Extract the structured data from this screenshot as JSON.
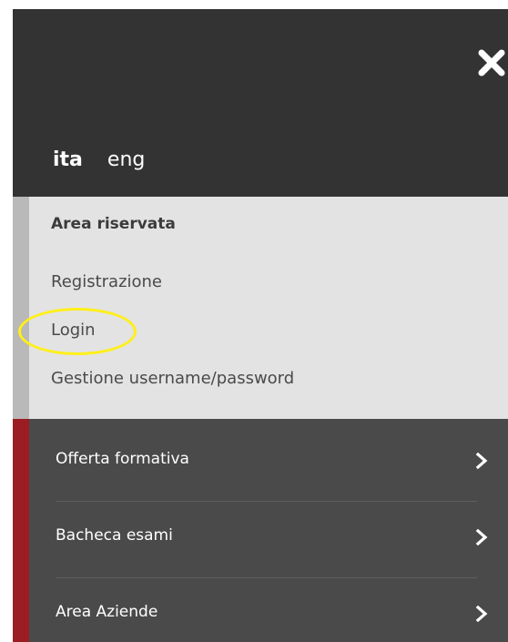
{
  "header": {
    "close_icon": "close-icon",
    "languages": {
      "active": "ita",
      "other": "eng"
    }
  },
  "reserved_area": {
    "title": "Area riservata",
    "links": {
      "registration": "Registrazione",
      "login": "Login",
      "manage": "Gestione username/password"
    },
    "highlight_color": "#ffef1a"
  },
  "nav": {
    "items": [
      {
        "label": "Offerta formativa",
        "icon": "chevron-right-icon"
      },
      {
        "label": "Bacheca esami",
        "icon": "chevron-right-icon"
      },
      {
        "label": "Area Aziende",
        "icon": "chevron-right-icon"
      }
    ]
  },
  "colors": {
    "header_bg": "#333333",
    "reserved_bg": "#e3e3e3",
    "reserved_stripe": "#b9b9b9",
    "nav_bg": "#4a4a4a",
    "nav_stripe": "#9b1d23"
  }
}
